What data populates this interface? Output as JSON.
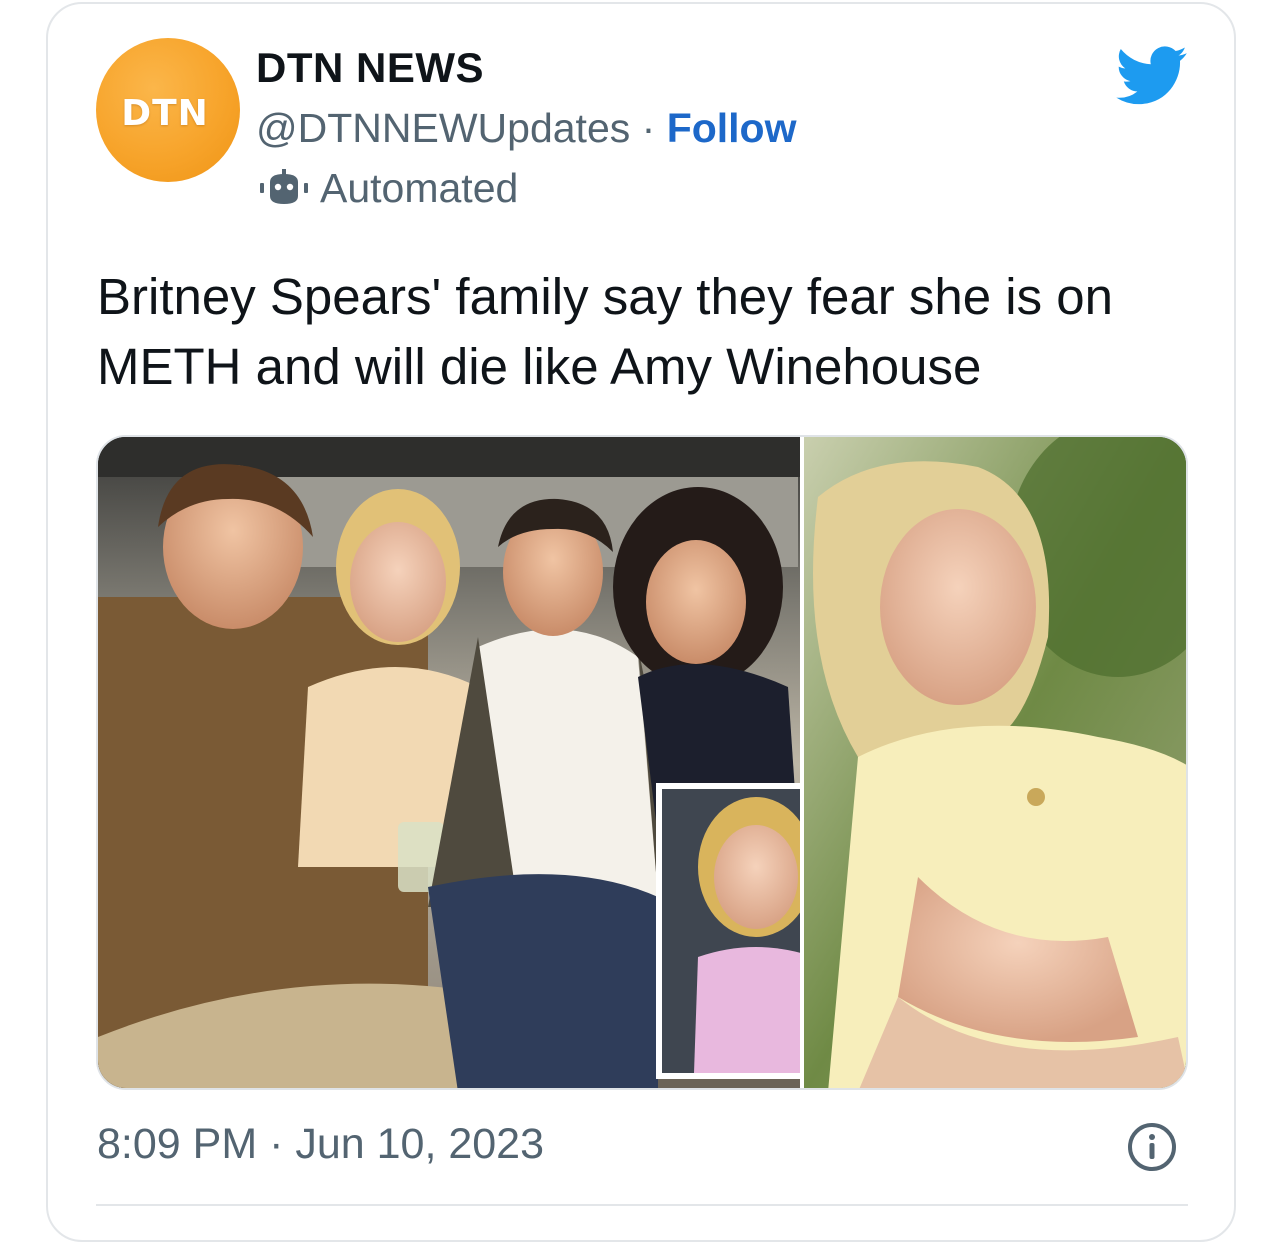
{
  "tweet": {
    "avatar_text": "DTN",
    "display_name": "DTN NEWS",
    "handle": "@DTNNEWUpdates",
    "separator": " · ",
    "follow_label": "Follow",
    "automated_label": "Automated",
    "text": "Britney Spears' family say they fear she is on METH and will die like Amy Winehouse",
    "timestamp": "8:09 PM · Jun 10, 2023"
  },
  "icons": {
    "bird": "twitter-bird-icon",
    "bot": "robot-icon",
    "info": "info-icon"
  },
  "colors": {
    "brand_blue": "#1d9bf0",
    "follow_blue": "#1d68c9",
    "text_primary": "#0f1419",
    "text_secondary": "#536471",
    "avatar_orange": "#f7a42b"
  }
}
